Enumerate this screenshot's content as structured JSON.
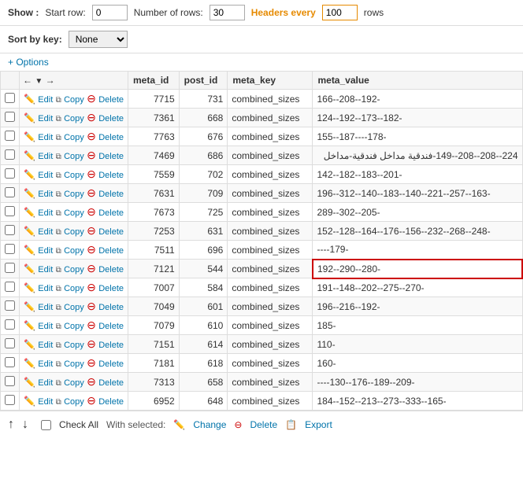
{
  "toolbar": {
    "show_label": "Show :",
    "start_row_label": "Start row:",
    "start_row_value": "0",
    "num_rows_label": "Number of rows:",
    "num_rows_value": "30",
    "headers_every_label": "Headers every",
    "headers_every_value": "100",
    "rows_label": "rows"
  },
  "sortbar": {
    "sort_by_label": "Sort by key:",
    "sort_options": [
      "None"
    ],
    "sort_selected": "None"
  },
  "options_link": "+ Options",
  "table": {
    "columns": [
      "",
      "",
      "meta_id",
      "post_id",
      "meta_key",
      "meta_value"
    ],
    "rows": [
      {
        "cb": "",
        "actions": [
          "Edit",
          "Copy",
          "Delete"
        ],
        "meta_id": "7715",
        "post_id": "731",
        "meta_key": "combined_sizes",
        "meta_value": "166--208--192-",
        "highlight": false
      },
      {
        "cb": "",
        "actions": [
          "Edit",
          "Copy",
          "Delete"
        ],
        "meta_id": "7361",
        "post_id": "668",
        "meta_key": "combined_sizes",
        "meta_value": "124--192--173--182-",
        "highlight": false
      },
      {
        "cb": "",
        "actions": [
          "Edit",
          "Copy",
          "Delete"
        ],
        "meta_id": "7763",
        "post_id": "676",
        "meta_key": "combined_sizes",
        "meta_value": "155--187----178-",
        "highlight": false
      },
      {
        "cb": "",
        "actions": [
          "Edit",
          "Copy",
          "Delete"
        ],
        "meta_id": "7469",
        "post_id": "686",
        "meta_key": "combined_sizes",
        "meta_value": "224--208--208--149-فندقية مداخل فندقية-مداخل",
        "highlight": false,
        "rtl": true
      },
      {
        "cb": "",
        "actions": [
          "Edit",
          "Copy",
          "Delete"
        ],
        "meta_id": "7559",
        "post_id": "702",
        "meta_key": "combined_sizes",
        "meta_value": "142--182--183--201-",
        "highlight": false
      },
      {
        "cb": "",
        "actions": [
          "Edit",
          "Copy",
          "Delete"
        ],
        "meta_id": "7631",
        "post_id": "709",
        "meta_key": "combined_sizes",
        "meta_value": "196--312--140--183--140--221--257--163-",
        "highlight": false
      },
      {
        "cb": "",
        "actions": [
          "Edit",
          "Copy",
          "Delete"
        ],
        "meta_id": "7673",
        "post_id": "725",
        "meta_key": "combined_sizes",
        "meta_value": "289--302--205-",
        "highlight": false
      },
      {
        "cb": "",
        "actions": [
          "Edit",
          "Copy",
          "Delete"
        ],
        "meta_id": "7253",
        "post_id": "631",
        "meta_key": "combined_sizes",
        "meta_value": "152--128--164--176--156--232--268--248-",
        "highlight": false
      },
      {
        "cb": "",
        "actions": [
          "Edit",
          "Copy",
          "Delete"
        ],
        "meta_id": "7511",
        "post_id": "696",
        "meta_key": "combined_sizes",
        "meta_value": "----179-",
        "highlight": false
      },
      {
        "cb": "",
        "actions": [
          "Edit",
          "Copy",
          "Delete"
        ],
        "meta_id": "7121",
        "post_id": "544",
        "meta_key": "combined_sizes",
        "meta_value": "192--290--280-",
        "highlight": true
      },
      {
        "cb": "",
        "actions": [
          "Edit",
          "Copy",
          "Delete"
        ],
        "meta_id": "7007",
        "post_id": "584",
        "meta_key": "combined_sizes",
        "meta_value": "191--148--202--275--270-",
        "highlight": false
      },
      {
        "cb": "",
        "actions": [
          "Edit",
          "Copy",
          "Delete"
        ],
        "meta_id": "7049",
        "post_id": "601",
        "meta_key": "combined_sizes",
        "meta_value": "196--216--192-",
        "highlight": false
      },
      {
        "cb": "",
        "actions": [
          "Edit",
          "Copy",
          "Delete"
        ],
        "meta_id": "7079",
        "post_id": "610",
        "meta_key": "combined_sizes",
        "meta_value": "185-",
        "highlight": false
      },
      {
        "cb": "",
        "actions": [
          "Edit",
          "Copy",
          "Delete"
        ],
        "meta_id": "7151",
        "post_id": "614",
        "meta_key": "combined_sizes",
        "meta_value": "110-",
        "highlight": false
      },
      {
        "cb": "",
        "actions": [
          "Edit",
          "Copy",
          "Delete"
        ],
        "meta_id": "7181",
        "post_id": "618",
        "meta_key": "combined_sizes",
        "meta_value": "160-",
        "highlight": false
      },
      {
        "cb": "",
        "actions": [
          "Edit",
          "Copy",
          "Delete"
        ],
        "meta_id": "7313",
        "post_id": "658",
        "meta_key": "combined_sizes",
        "meta_value": "----130--176--189--209-",
        "highlight": false
      },
      {
        "cb": "",
        "actions": [
          "Edit",
          "Copy",
          "Delete"
        ],
        "meta_id": "6952",
        "post_id": "648",
        "meta_key": "combined_sizes",
        "meta_value": "184--152--213--273--333--165-",
        "highlight": false
      }
    ]
  },
  "footer": {
    "check_all_label": "Check All",
    "with_selected_label": "With selected:",
    "change_label": "Change",
    "delete_label": "Delete",
    "export_label": "Export"
  }
}
